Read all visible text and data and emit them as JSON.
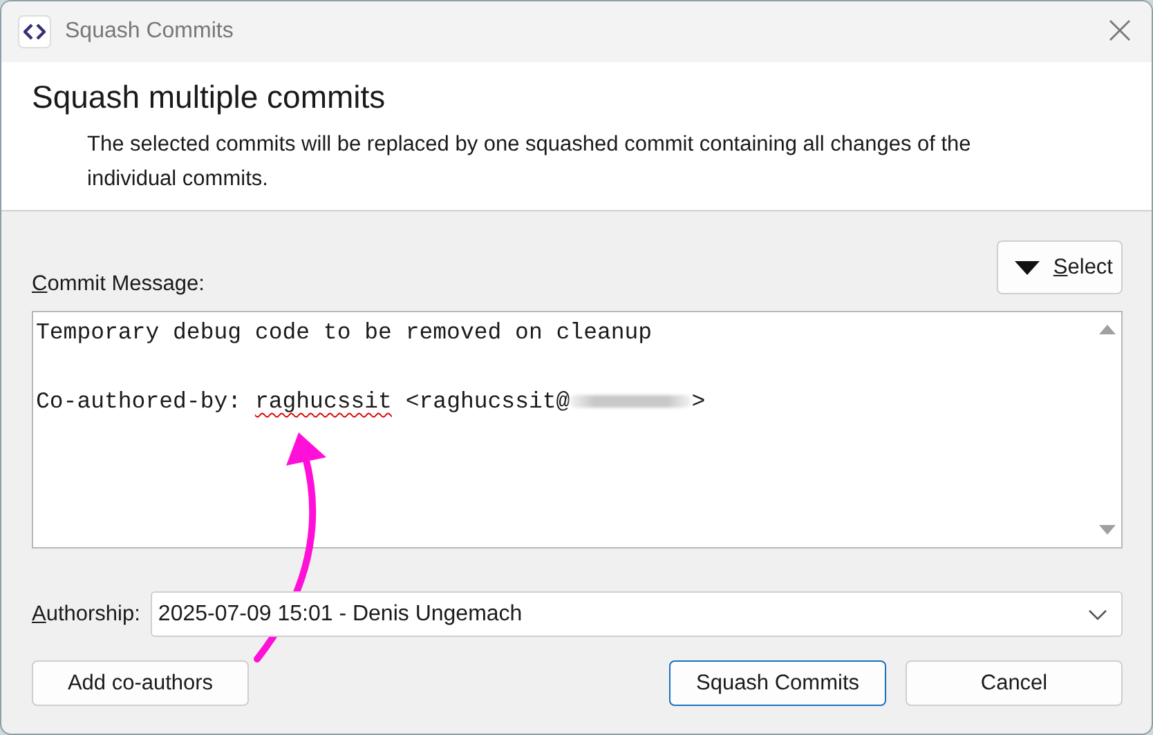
{
  "window": {
    "title": "Squash Commits"
  },
  "header": {
    "title": "Squash multiple commits",
    "description": "The selected commits will be replaced by one squashed commit containing all changes of the individual commits."
  },
  "message": {
    "label": "Commit Message:",
    "mnemonic_underlined": true,
    "select_button": {
      "label": "Select",
      "mnemonic_underlined": true
    },
    "lines": [
      {
        "kind": "line",
        "segments": [
          {
            "kind": "text",
            "text": "Temporary debug code to be removed on cleanup"
          }
        ]
      },
      {
        "kind": "paragraph",
        "segments": [
          {
            "kind": "text",
            "text": "Co-authored-by: "
          },
          {
            "kind": "misspelled",
            "text": "raghucssit"
          },
          {
            "kind": "text",
            "text": " <raghucssit@"
          },
          {
            "kind": "redacted"
          },
          {
            "kind": "text",
            "text": ">"
          }
        ]
      }
    ]
  },
  "authorship": {
    "label": "Authorship:",
    "mnemonic_underlined": true,
    "value": "2025-07-09 15:01 - Denis Ungemach"
  },
  "buttons": [
    {
      "label": "Add co-authors",
      "kind": "left",
      "default": false
    },
    {
      "label": "Squash Commits",
      "kind": "right",
      "default": true
    },
    {
      "label": "Cancel",
      "kind": "right",
      "default": false
    }
  ],
  "annotation": {
    "kind": "arrow"
  }
}
